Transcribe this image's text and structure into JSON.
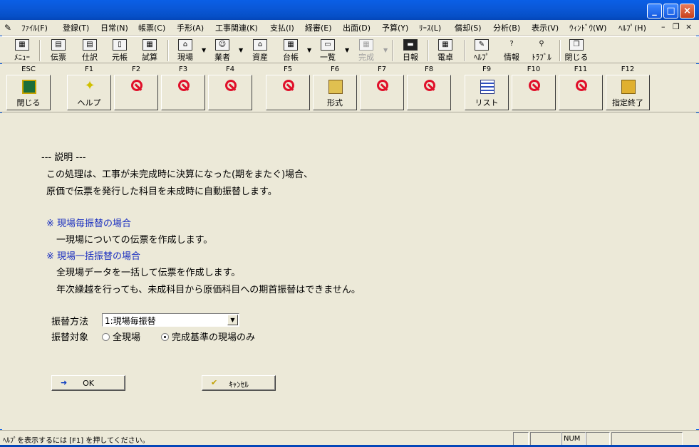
{
  "menu": {
    "items": [
      "ﾌｧｲﾙ(F)",
      "登録(T)",
      "日常(N)",
      "帳票(C)",
      "手形(A)",
      "工事関連(K)",
      "支払(I)",
      "経審(E)",
      "出面(D)",
      "予算(Y)",
      "ﾘｰｽ(L)",
      "償却(S)",
      "分析(B)",
      "表示(V)",
      "ｳｨﾝﾄﾞｳ(W)",
      "ﾍﾙﾌﾟ(H)"
    ]
  },
  "toolbar": {
    "buttons": [
      "ﾒﾆｭｰ",
      "伝票",
      "仕訳",
      "元帳",
      "試算",
      "現場",
      "業者",
      "資産",
      "台帳",
      "一覧",
      "完成",
      "日報",
      "電卓",
      "ﾍﾙﾌﾟ",
      "情報",
      "ﾄﾗﾌﾞﾙ",
      "閉じる"
    ]
  },
  "fkeys": [
    {
      "key": "ESC",
      "label": "閉じる"
    },
    {
      "key": "F1",
      "label": "ヘルプ"
    },
    {
      "key": "F2",
      "label": ""
    },
    {
      "key": "F3",
      "label": ""
    },
    {
      "key": "F4",
      "label": ""
    },
    {
      "key": "F5",
      "label": ""
    },
    {
      "key": "F6",
      "label": "形式"
    },
    {
      "key": "F7",
      "label": ""
    },
    {
      "key": "F8",
      "label": ""
    },
    {
      "key": "F9",
      "label": "リスト"
    },
    {
      "key": "F10",
      "label": ""
    },
    {
      "key": "F11",
      "label": ""
    },
    {
      "key": "F12",
      "label": "指定終了"
    }
  ],
  "content": {
    "heading": "--- 説明 ---",
    "desc_line1": "この処理は、工事が未完成時に決算になった(期をまたぐ)場合、",
    "desc_line2": "原価で伝票を発行した科目を未成時に自動振替します。",
    "opt1_title": "※ 現場毎振替の場合",
    "opt1_desc": "一現場についての伝票を作成します。",
    "opt2_title": "※ 現場一括振替の場合",
    "opt2_desc1": "全現場データを一括して伝票を作成します。",
    "opt2_desc2": "年次繰越を行っても、未成科目から原価科目への期首振替はできません。"
  },
  "form": {
    "method_label": "振替方法",
    "method_value": "1:現場毎振替",
    "target_label": "振替対象",
    "target_options": [
      "全現場",
      "完成基準の現場のみ"
    ],
    "target_selected": "完成基準の現場のみ"
  },
  "buttons": {
    "ok_label": "OK",
    "cancel_label": "ｷｬﾝｾﾙ"
  },
  "status": {
    "help_text": "ﾍﾙﾌﾟを表示するには [F1] を押してください。",
    "num": "NUM"
  },
  "colors": {
    "titlebar": "#0a5fe6",
    "face": "#ece9d8",
    "accent_text": "#1a2fc0",
    "no_icon": "#e0102a"
  }
}
